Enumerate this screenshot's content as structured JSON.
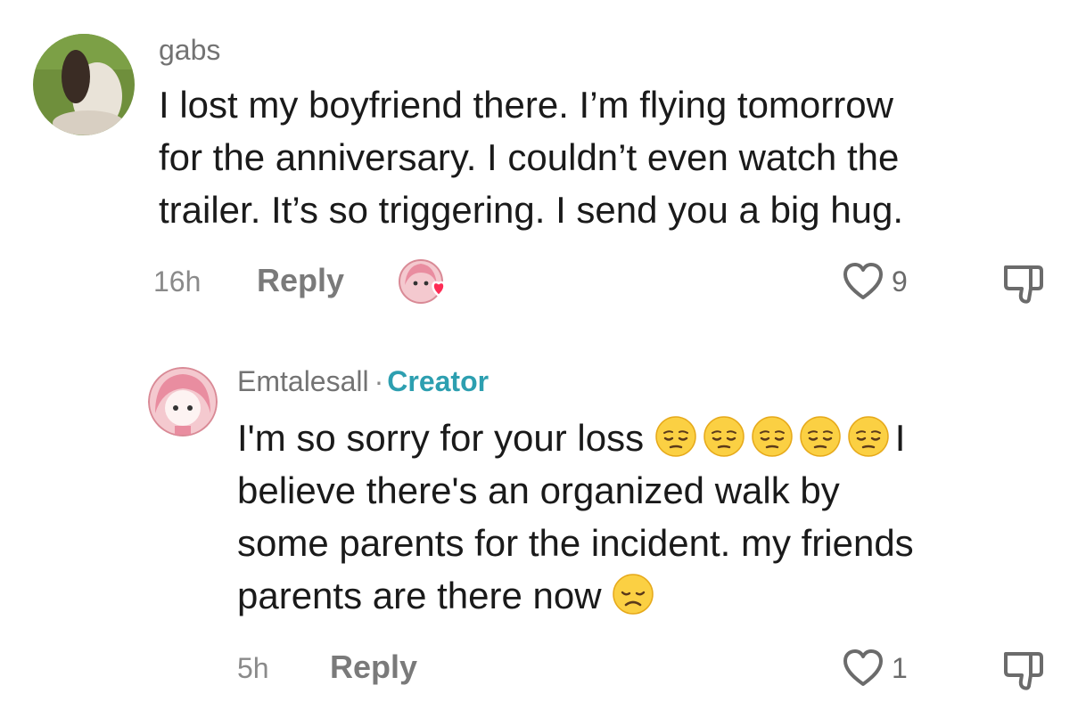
{
  "comments": [
    {
      "username": "gabs",
      "text_lines": [
        "I lost my boyfriend there. I’m flying tomorrow",
        "for the anniversary. I couldn’t even watch the",
        "trailer. It’s so triggering. I send you a big hug."
      ],
      "time": "16h",
      "reply_label": "Reply",
      "like_count": "9",
      "liked_by_creator": true
    },
    {
      "username": "Emtalesall",
      "separator": "·",
      "badge": "Creator",
      "text_lines": [
        "I'm so sorry for your loss",
        "believe there's an organized walk by",
        "some parents for the incident. my friends",
        "parents are there now"
      ],
      "line1_suffix": "I",
      "line1_emoji": [
        "pensive-emoji",
        "pensive-emoji",
        "pensive-emoji",
        "pensive-emoji",
        "pensive-emoji"
      ],
      "line4_emoji": "disappointed-emoji",
      "time": "5h",
      "reply_label": "Reply",
      "like_count": "1"
    }
  ],
  "colors": {
    "creator_accent": "#2d9fb0",
    "heart_red": "#fe2c55"
  }
}
